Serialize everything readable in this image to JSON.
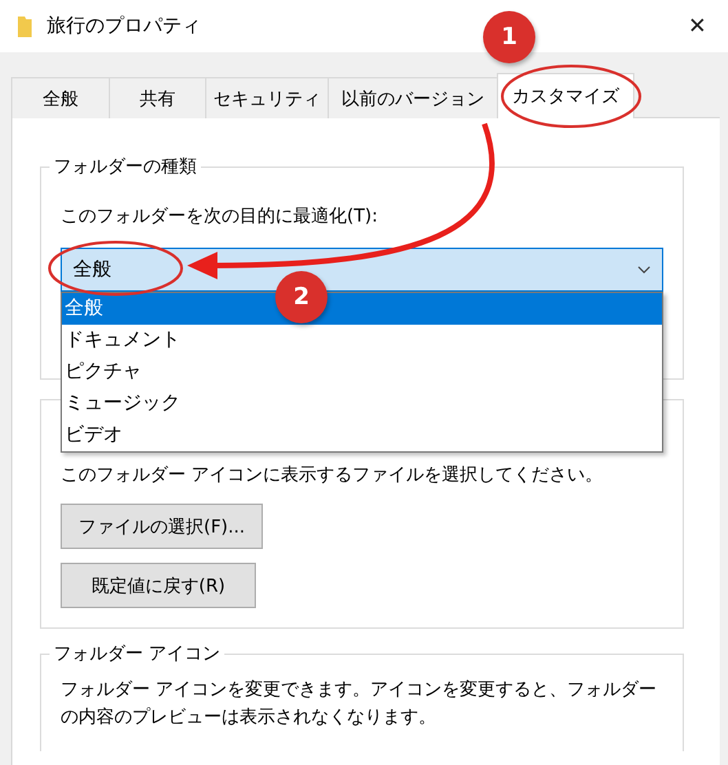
{
  "window": {
    "title": "旅行のプロパティ",
    "close": "✕"
  },
  "tabs": [
    {
      "label": "全般",
      "selected": false
    },
    {
      "label": "共有",
      "selected": false
    },
    {
      "label": "セキュリティ",
      "selected": false
    },
    {
      "label": "以前のバージョン",
      "selected": false
    },
    {
      "label": "カスタマイズ",
      "selected": true
    }
  ],
  "folder_type": {
    "title": "フォルダーの種類",
    "label": "このフォルダーを次の目的に最適化(T):",
    "value": "全般",
    "options": [
      {
        "label": "全般",
        "selected": true
      },
      {
        "label": "ドキュメント",
        "selected": false
      },
      {
        "label": "ピクチャ",
        "selected": false
      },
      {
        "label": "ミュージック",
        "selected": false
      },
      {
        "label": "ビデオ",
        "selected": false
      }
    ]
  },
  "folder_picture": {
    "text": "このフォルダー アイコンに表示するファイルを選択してください。",
    "buttons": [
      "ファイルの選択(F)...",
      "既定値に戻す(R)"
    ]
  },
  "folder_icon": {
    "title": "フォルダー アイコン",
    "text": "フォルダー アイコンを変更できます。アイコンを変更すると、フォルダーの内容のプレビューは表示されなくなります。"
  },
  "annotations": [
    {
      "label": "1"
    },
    {
      "label": "2"
    }
  ]
}
